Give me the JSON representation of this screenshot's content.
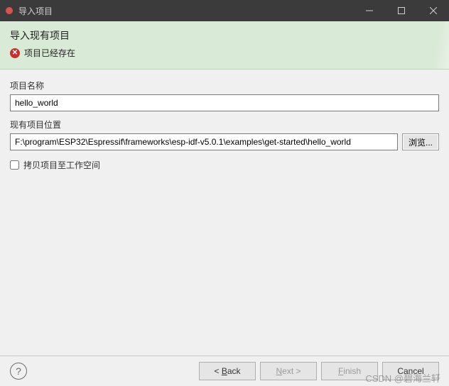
{
  "window": {
    "title": "导入项目"
  },
  "header": {
    "title": "导入现有项目",
    "error": "项目已经存在"
  },
  "form": {
    "project_name_label": "项目名称",
    "project_name_value": "hello_world",
    "location_label": "现有项目位置",
    "location_value": "F:\\program\\ESP32\\Espressif\\frameworks\\esp-idf-v5.0.1\\examples\\get-started\\hello_world",
    "browse_label": "浏览...",
    "copy_checkbox_label": "拷贝项目至工作空间",
    "copy_checked": false
  },
  "footer": {
    "help_symbol": "?",
    "back_prefix": "< ",
    "back_mnemonic": "B",
    "back_suffix": "ack",
    "next_mnemonic": "N",
    "next_suffix": "ext >",
    "finish_mnemonic": "F",
    "finish_suffix": "inish",
    "cancel_label": "Cancel"
  },
  "watermark": "CSDN @碧海兰轩"
}
